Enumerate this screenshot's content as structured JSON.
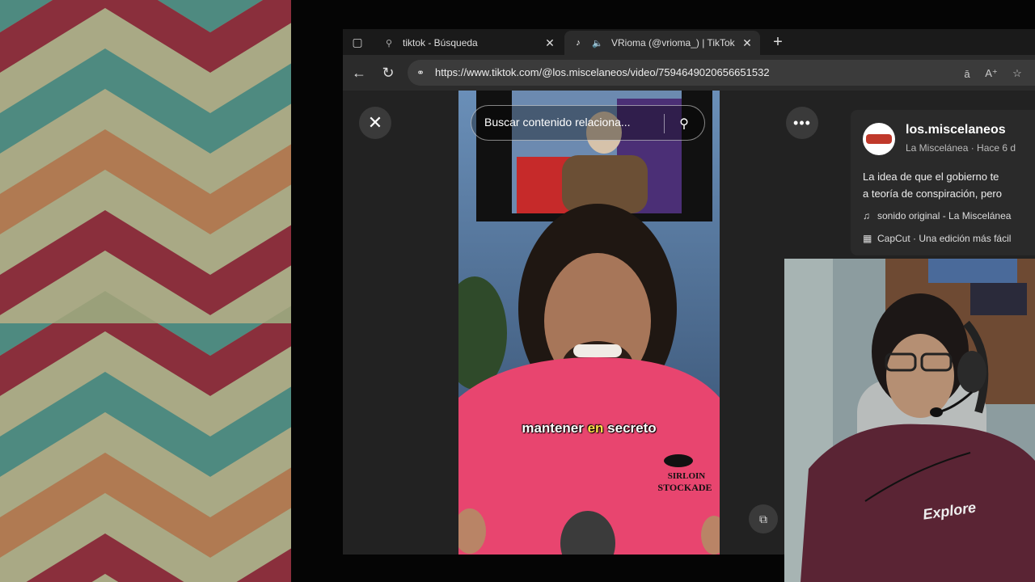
{
  "browser": {
    "tabs": [
      {
        "title": "tiktok - Búsqueda",
        "active": false
      },
      {
        "title": "VRioma (@vrioma_) | TikTok",
        "active": true
      }
    ],
    "url": "https://www.tiktok.com/@los.miscelaneos/video/7594649020656651532"
  },
  "page": {
    "search_placeholder": "Buscar contenido relaciona...",
    "caption": {
      "before": "mantener ",
      "highlight": "en",
      "after": " secreto"
    },
    "shirt_text_top": "SIRLOIN",
    "shirt_text_bottom": "STOCKADE",
    "tv_note": "",
    "author": {
      "name": "los.miscelaneos",
      "meta": "La Miscelánea · Hace 6 d",
      "description_line1": "La idea de que el gobierno te",
      "description_line2": "a teoría de conspiración, pero",
      "sound": "sonido original - La Miscelánea",
      "capcut": "CapCut · Una edición más fácil"
    }
  },
  "webcam": {
    "shirt_text": "Explore"
  },
  "colors": {
    "accent_caption": "#ffe14a",
    "shirt": "#e8456f",
    "hoodie": "#5a2434"
  }
}
